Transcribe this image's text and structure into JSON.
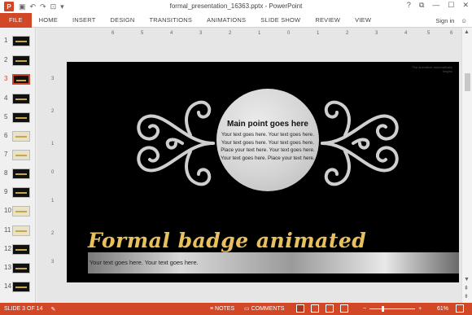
{
  "window": {
    "title": "formal_presentation_16363.pptx - PowerPoint",
    "app_logo": "P",
    "controls": [
      "?",
      "⧉",
      "—",
      "☐",
      "✕"
    ]
  },
  "qat": {
    "save_icon": "save-icon",
    "undo_icon": "undo-icon",
    "redo_icon": "redo-icon",
    "present_icon": "present-icon",
    "more": "▾"
  },
  "ribbon": {
    "tabs": [
      "FILE",
      "HOME",
      "INSERT",
      "DESIGN",
      "TRANSITIONS",
      "ANIMATIONS",
      "SLIDE SHOW",
      "REVIEW",
      "VIEW"
    ],
    "sign_in": "Sign in"
  },
  "thumbnails": {
    "numbers": [
      "1",
      "2",
      "3",
      "4",
      "5",
      "6",
      "7",
      "8",
      "9",
      "10",
      "11",
      "12",
      "13",
      "14"
    ],
    "active": 3
  },
  "ruler": {
    "h": [
      "6",
      "5",
      "4",
      "3",
      "2",
      "1",
      "0",
      "1",
      "2",
      "3",
      "4",
      "5",
      "6"
    ],
    "v": [
      "3",
      "2",
      "1",
      "0",
      "1",
      "2",
      "3"
    ]
  },
  "slide": {
    "anim_note": "The animation automatically begins",
    "badge_title": "Main point goes here",
    "badge_body": "Your text goes here. Your text goes here. Your text goes here. Your text goes here. Place your text here. Your text goes here. Your text goes here. Place your text here.",
    "big_title": "Formal badge animated",
    "band_text": "Your text goes here. Your text goes here."
  },
  "status": {
    "slide_info": "SLIDE 3 OF 14",
    "notes": "NOTES",
    "comments": "COMMENTS",
    "zoom": "61%",
    "zoom_level": 0.61
  },
  "colors": {
    "accent": "#d24726",
    "title_gold": "#e8c15e",
    "slide_bg": "#000000"
  }
}
